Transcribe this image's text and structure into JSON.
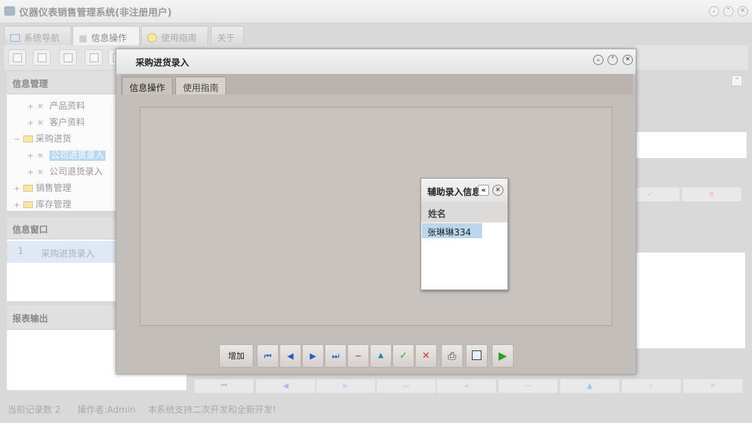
{
  "app": {
    "title": "仪器仪表销售管理系统(非注册用户)"
  },
  "main_tabs": [
    {
      "label": "系统导航",
      "active": false
    },
    {
      "label": "信息操作",
      "active": true
    },
    {
      "label": "使用指南",
      "active": false
    },
    {
      "label": "关于",
      "active": false
    }
  ],
  "left": {
    "info_mgmt_title": "信息管理",
    "tree": [
      {
        "label": "产品资料",
        "expander": "+",
        "kind": "leaf"
      },
      {
        "label": "客户资料",
        "expander": "+",
        "kind": "leaf"
      },
      {
        "label": "采购进货",
        "expander": "−",
        "kind": "folder"
      },
      {
        "label": "公司进货录入",
        "expander": "+",
        "kind": "leaf",
        "selected": true
      },
      {
        "label": "公司退货录入",
        "expander": "+",
        "kind": "leaf"
      },
      {
        "label": "销售管理",
        "expander": "+",
        "kind": "folder"
      },
      {
        "label": "库存管理",
        "expander": "+",
        "kind": "folder"
      }
    ],
    "info_window_title": "信息窗口",
    "window_rows": [
      {
        "index": "1",
        "label": "采购进货录入"
      }
    ],
    "report_title": "报表输出"
  },
  "status": {
    "record_count": "当前记录数 2",
    "operator": "操作者:Admin",
    "message": "本系统支持二次开发和全新开发!"
  },
  "dialog": {
    "title": "采购进货录入",
    "tabs": [
      {
        "label": "信息操作",
        "active": true
      },
      {
        "label": "使用指南",
        "active": false
      }
    ],
    "helper": {
      "title": "辅助录入信息",
      "column": "姓名",
      "rows": [
        "张琳琳334"
      ]
    },
    "add_label": "增加"
  },
  "colors": {
    "dialog_bg": "#c4bebb",
    "selection": "#bcd6ee",
    "confirm_green": "#3a9a3a",
    "cancel_red": "#d03a2a",
    "nav_blue": "#1f5fc0"
  }
}
